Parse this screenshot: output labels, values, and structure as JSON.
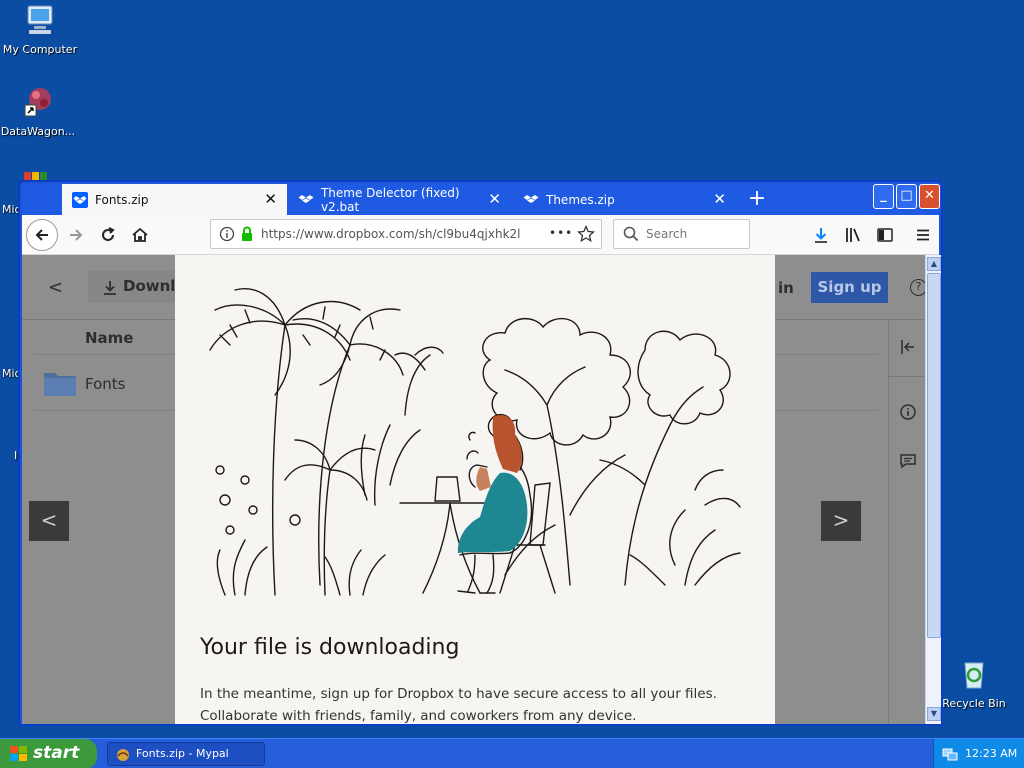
{
  "desktop": {
    "icons": [
      {
        "label": "My Computer"
      },
      {
        "label": "DataWagon..."
      },
      {
        "label": "Recycle Bin"
      }
    ],
    "partial_labels": [
      "Mic",
      "Mic",
      "I"
    ]
  },
  "browser": {
    "tabs": [
      {
        "title": "Fonts.zip",
        "active": true
      },
      {
        "title": "Theme Delector (fixed) v2.bat",
        "active": false
      },
      {
        "title": "Themes.zip",
        "active": false
      }
    ],
    "new_tab_label": "+",
    "url": "https://www.dropbox.com/sh/cl9bu4qjxhk2l",
    "url_menu_label": "•••",
    "search_placeholder": "Search",
    "colors": {
      "accent": "#1f5be2",
      "dropbox_blue": "#0061fe"
    }
  },
  "page": {
    "back_label": "<",
    "download_label": "Downlo",
    "signin_label": "in",
    "signup_label": "Sign up",
    "help_label": "?",
    "column_header": "Name",
    "folder_name": "Fonts",
    "prev_label": "<",
    "next_label": ">"
  },
  "modal": {
    "title": "Your file is downloading",
    "body_line1": "In the meantime, sign up for Dropbox to have secure access to all your files.",
    "body_line2": "Collaborate with friends, family, and coworkers from any device."
  },
  "taskbar": {
    "start_label": "start",
    "task_label": "Fonts.zip - Mypal",
    "clock": "12:23 AM"
  }
}
